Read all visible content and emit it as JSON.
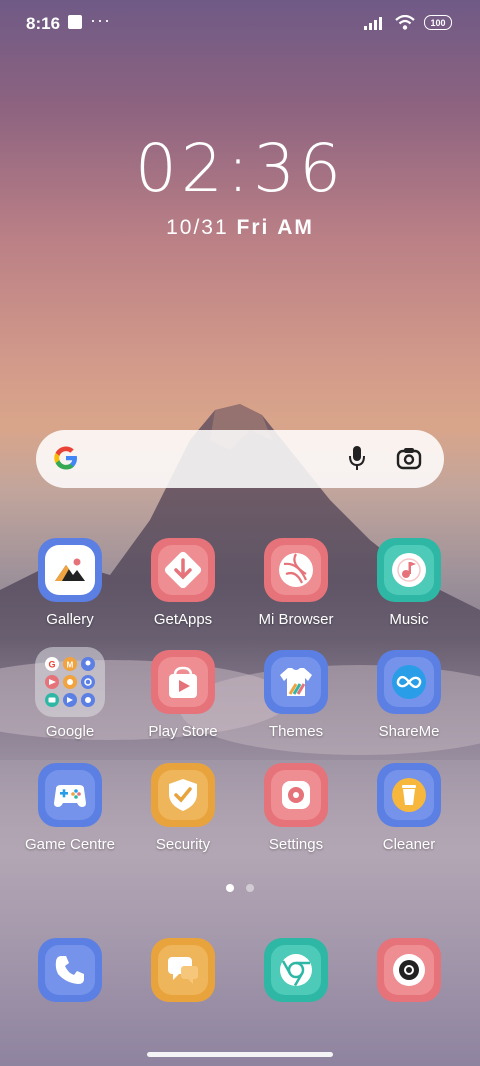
{
  "status_bar": {
    "time": "8:16",
    "battery": "100",
    "more": "···"
  },
  "lockclock": {
    "time": "02:36",
    "date": "10/31",
    "day": "Fri",
    "ampm": "AM"
  },
  "search": {
    "placeholder": ""
  },
  "apps": [
    {
      "label": "Gallery"
    },
    {
      "label": "GetApps"
    },
    {
      "label": "Mi Browser"
    },
    {
      "label": "Music"
    },
    {
      "label": "Google"
    },
    {
      "label": "Play Store"
    },
    {
      "label": "Themes"
    },
    {
      "label": "ShareMe"
    },
    {
      "label": "Game Centre"
    },
    {
      "label": "Security"
    },
    {
      "label": "Settings"
    },
    {
      "label": "Cleaner"
    }
  ],
  "dock": [
    {
      "icon": "phone-icon"
    },
    {
      "icon": "messages-icon"
    },
    {
      "icon": "chrome-icon"
    },
    {
      "icon": "camera-icon"
    }
  ],
  "page_indicator": {
    "pages": 2,
    "current": 1
  },
  "colors": {
    "blue": "#5b7fe3",
    "red": "#e6727a",
    "teal": "#2fb7a5",
    "orange": "#e8a33d"
  }
}
